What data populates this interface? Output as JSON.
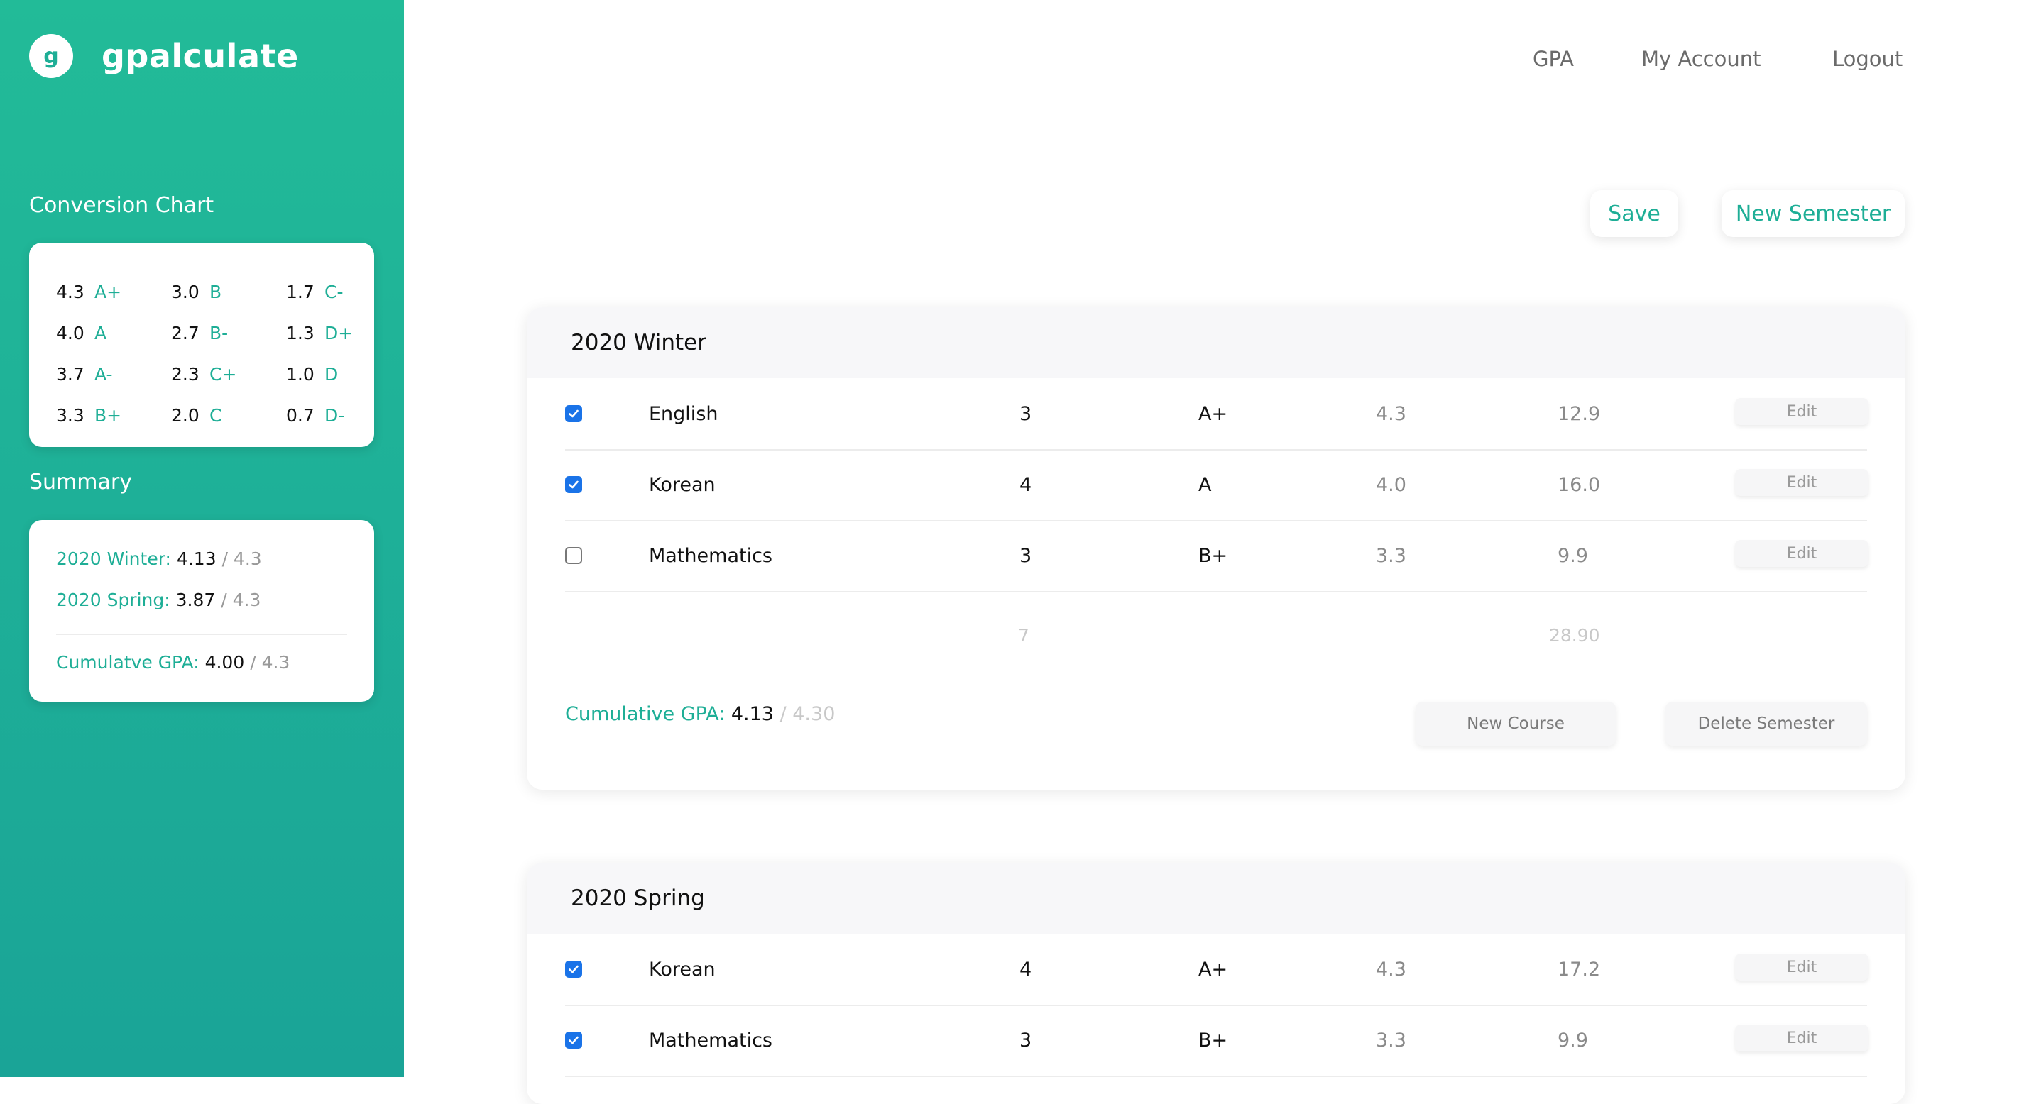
{
  "app": {
    "logo_letter": "g",
    "name": "gpalculate"
  },
  "nav": {
    "gpa": "GPA",
    "account": "My Account",
    "logout": "Logout"
  },
  "actions": {
    "save": "Save",
    "new_semester": "New Semester"
  },
  "conversion_chart": {
    "title": "Conversion Chart",
    "entries": [
      {
        "value": "4.3",
        "grade": "A+"
      },
      {
        "value": "3.0",
        "grade": "B"
      },
      {
        "value": "1.7",
        "grade": "C-"
      },
      {
        "value": "4.0",
        "grade": "A"
      },
      {
        "value": "2.7",
        "grade": "B-"
      },
      {
        "value": "1.3",
        "grade": "D+"
      },
      {
        "value": "3.7",
        "grade": "A-"
      },
      {
        "value": "2.3",
        "grade": "C+"
      },
      {
        "value": "1.0",
        "grade": "D"
      },
      {
        "value": "3.3",
        "grade": "B+"
      },
      {
        "value": "2.0",
        "grade": "C"
      },
      {
        "value": "0.7",
        "grade": "D-"
      }
    ]
  },
  "summary": {
    "title": "Summary",
    "semesters": [
      {
        "label": "2020 Winter:",
        "gpa": "4.13",
        "max": "/ 4.3"
      },
      {
        "label": "2020 Spring:",
        "gpa": "3.87",
        "max": "/ 4.3"
      }
    ],
    "cumulative": {
      "label": "Cumulatve GPA:",
      "gpa": "4.00",
      "max": "/ 4.3"
    }
  },
  "semesters": [
    {
      "title": "2020 Winter",
      "courses": [
        {
          "checked": true,
          "name": "English",
          "credits": "3",
          "grade": "A+",
          "points": "4.3",
          "total": "12.9",
          "edit": "Edit"
        },
        {
          "checked": true,
          "name": "Korean",
          "credits": "4",
          "grade": "A",
          "points": "4.0",
          "total": "16.0",
          "edit": "Edit"
        },
        {
          "checked": false,
          "name": "Mathematics",
          "credits": "3",
          "grade": "B+",
          "points": "3.3",
          "total": "9.9",
          "edit": "Edit"
        }
      ],
      "total_credits": "7",
      "total_points": "28.90",
      "cumulative": {
        "label": "Cumulative GPA:",
        "gpa": "4.13",
        "max": "/ 4.30"
      },
      "new_course": "New Course",
      "delete_semester": "Delete Semester"
    },
    {
      "title": "2020 Spring",
      "courses": [
        {
          "checked": true,
          "name": "Korean",
          "credits": "4",
          "grade": "A+",
          "points": "4.3",
          "total": "17.2",
          "edit": "Edit"
        },
        {
          "checked": true,
          "name": "Mathematics",
          "credits": "3",
          "grade": "B+",
          "points": "3.3",
          "total": "9.9",
          "edit": "Edit"
        }
      ]
    }
  ]
}
